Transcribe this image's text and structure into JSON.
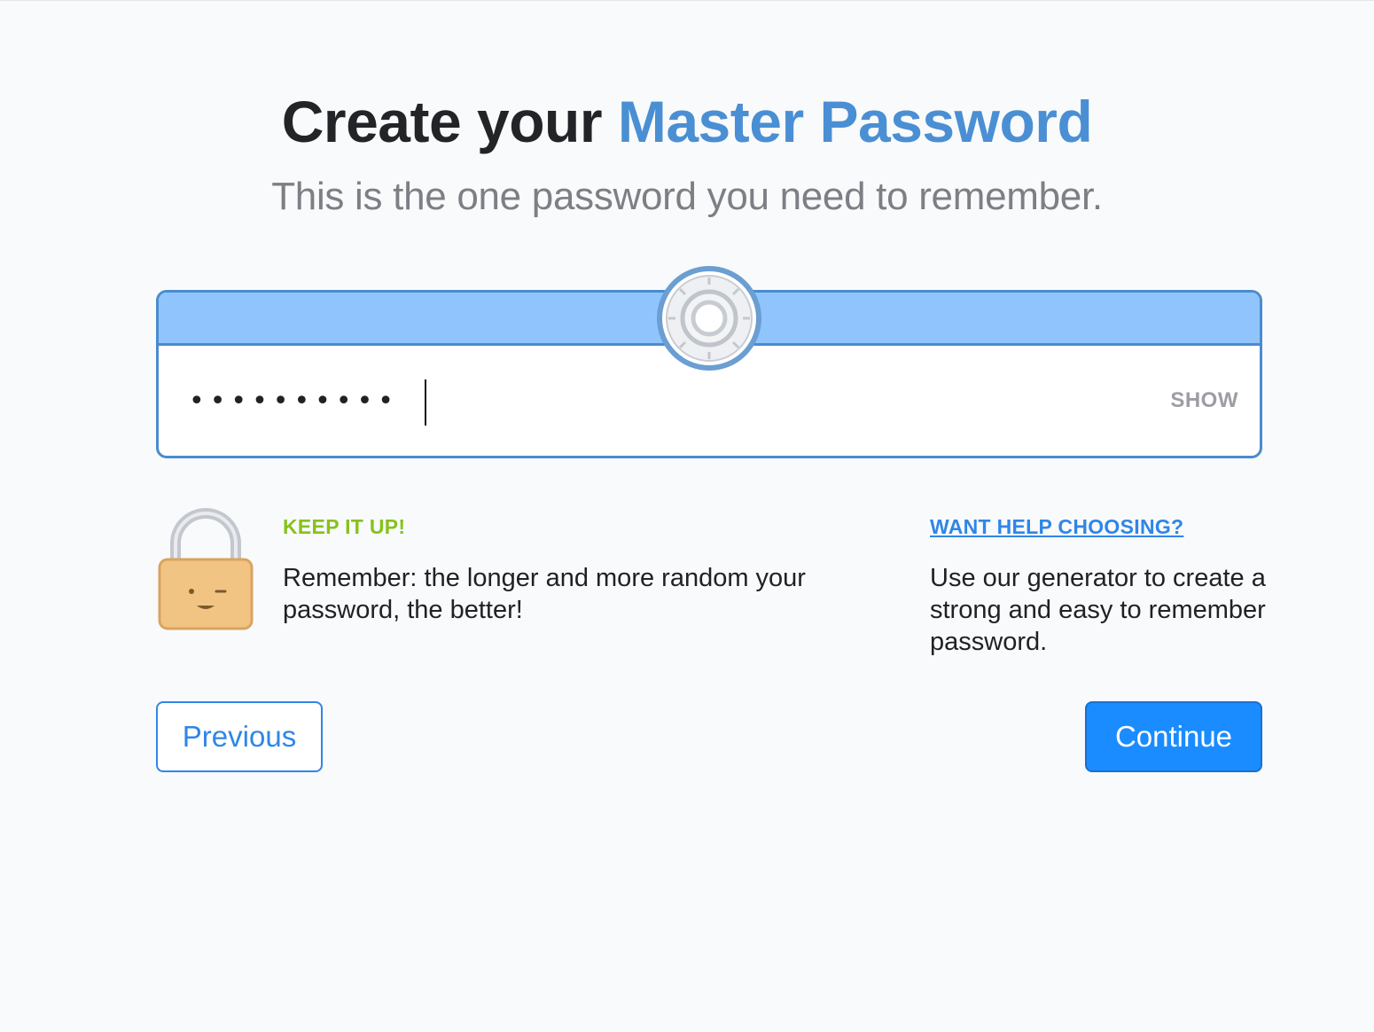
{
  "header": {
    "title_prefix": "Create your",
    "title_accent": "Master Password",
    "subtitle": "This is the one password you need to remember."
  },
  "password_field": {
    "masked_value": "••••••••••",
    "show_label": "SHOW"
  },
  "strength_tip": {
    "heading": "KEEP IT UP!",
    "body": "Remember: the longer and more random your password, the better!"
  },
  "help": {
    "link_label": "WANT HELP CHOOSING?",
    "body": "Use our generator to create a strong and easy to remember password."
  },
  "buttons": {
    "previous": "Previous",
    "continue": "Continue"
  },
  "icons": {
    "dial": "vault-dial-icon",
    "lock": "padlock-face-icon"
  },
  "colors": {
    "accent": "#4a8fd4",
    "band": "#8fc5fc",
    "border": "#4b8bce",
    "positive": "#86c21c",
    "link": "#2f86e8",
    "primary_button": "#1a8cff"
  }
}
